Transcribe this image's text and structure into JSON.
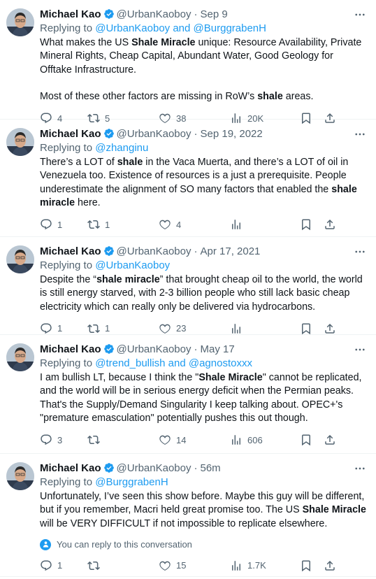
{
  "tweets": [
    {
      "name": "Michael Kao",
      "handle": "@UrbanKaoboy",
      "time": "Sep 9",
      "reply_prefix": "Replying to ",
      "reply_to": "@UrbanKaoboy and @BurggrabenH",
      "text_parts": [
        {
          "t": "What makes the US "
        },
        {
          "t": "Shale Miracle",
          "b": true
        },
        {
          "t": " unique: Resource Availability, Private Mineral Rights, Cheap Capital, Abundant Water, Good Geology for Offtake Infrastructure.\n\nMost of these other factors are missing in RoW’s "
        },
        {
          "t": "shale",
          "b": true
        },
        {
          "t": " areas."
        }
      ],
      "replies": "4",
      "retweets": "5",
      "likes": "38",
      "views": "20K"
    },
    {
      "name": "Michael Kao",
      "handle": "@UrbanKaoboy",
      "time": "Sep 19, 2022",
      "reply_prefix": "Replying to ",
      "reply_to": "@zhanginu",
      "text_parts": [
        {
          "t": "There’s a LOT of "
        },
        {
          "t": "shale",
          "b": true
        },
        {
          "t": " in the Vaca Muerta, and there’s a LOT of oil in Venezuela too. Existence of resources is a just a prerequisite. People underestimate the alignment of SO many factors that enabled the "
        },
        {
          "t": "shale miracle",
          "b": true
        },
        {
          "t": " here."
        }
      ],
      "replies": "1",
      "retweets": "1",
      "likes": "4",
      "views": ""
    },
    {
      "name": "Michael Kao",
      "handle": "@UrbanKaoboy",
      "time": "Apr 17, 2021",
      "reply_prefix": "Replying to ",
      "reply_to": "@UrbanKaoboy",
      "text_parts": [
        {
          "t": "Despite the “"
        },
        {
          "t": "shale miracle",
          "b": true
        },
        {
          "t": "” that brought cheap oil to the world, the world is still energy starved, with 2-3 billion people who still lack basic cheap electricity which can really only be delivered via hydrocarbons."
        }
      ],
      "replies": "1",
      "retweets": "1",
      "likes": "23",
      "views": ""
    },
    {
      "name": "Michael Kao",
      "handle": "@UrbanKaoboy",
      "time": "May 17",
      "reply_prefix": "Replying to ",
      "reply_to": "@trend_bullish and @agnostoxxx",
      "text_parts": [
        {
          "t": "I am bullish LT, because I think the \""
        },
        {
          "t": "Shale Miracle",
          "b": true
        },
        {
          "t": "\" cannot be replicated, and the world will be in serious energy deficit when the Permian peaks. That's the Supply/Demand Singularity I keep talking about. OPEC+'s \"premature emasculation\" potentially pushes this out though."
        }
      ],
      "replies": "3",
      "retweets": "",
      "likes": "14",
      "views": "606"
    },
    {
      "name": "Michael Kao",
      "handle": "@UrbanKaoboy",
      "time": "56m",
      "reply_prefix": "Replying to ",
      "reply_to": "@BurggrabenH",
      "text_parts": [
        {
          "t": "Unfortunately, I’ve seen this show before. Maybe this guy will be different, but if you remember, Macri held great promise too. The US "
        },
        {
          "t": "Shale Miracle",
          "b": true
        },
        {
          "t": " will be VERY DIFFICULT if not impossible to replicate elsewhere."
        }
      ],
      "conversation_note": "You can reply to this conversation",
      "replies": "1",
      "retweets": "",
      "likes": "15",
      "views": "1.7K"
    }
  ],
  "separator_dot": "·",
  "colors": {
    "accent": "#1d9bf0",
    "secondary_text": "#536471",
    "primary_text": "#0f1419",
    "border": "#eff3f4"
  },
  "icons": [
    "verified-badge-icon",
    "more-icon",
    "reply-icon",
    "retweet-icon",
    "like-icon",
    "views-icon",
    "bookmark-icon",
    "share-icon",
    "people-icon"
  ]
}
